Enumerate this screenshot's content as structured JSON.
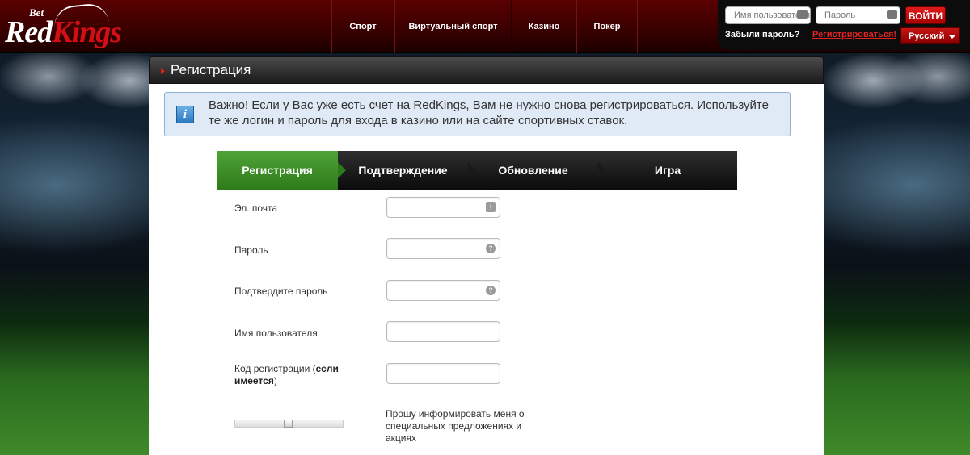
{
  "header": {
    "logo": {
      "bet": "Bet",
      "red": "Red",
      "kings": "Kings"
    },
    "nav": [
      {
        "label": "Спорт"
      },
      {
        "label": "Виртуальный спорт"
      },
      {
        "label": "Казино"
      },
      {
        "label": "Покер"
      }
    ],
    "login": {
      "username_placeholder": "Имя пользователя",
      "password_placeholder": "Пароль",
      "submit_label": "ВОЙТИ",
      "forgot_label": "Забыли пароль?",
      "register_label": "Регистрироваться!",
      "language": "Русский"
    }
  },
  "page": {
    "title": "Регистрация",
    "notice": {
      "icon": "info-icon",
      "text": "Важно! Если у Вас уже есть счет на RedKings, Вам не нужно снова регистрироваться. Используйте те же логин и пароль для входа в казино или на сайте спортивных ставок."
    },
    "steps": [
      {
        "label": "Регистрация",
        "active": true
      },
      {
        "label": "Подтверждение",
        "active": false
      },
      {
        "label": "Обновление",
        "active": false
      },
      {
        "label": "Игра",
        "active": false
      }
    ],
    "fields": {
      "email_label": "Эл. почта",
      "password_label": "Пароль",
      "confirm_label": "Подтвердите пароль",
      "username_label": "Имя пользователя",
      "regcode_label": "Код регистрации (",
      "regcode_bold": "если имеется",
      "regcode_close": ")"
    },
    "newsletter": {
      "text": "Прошу информировать меня о специальных предложениях и акциях",
      "toggle_value": 0.5
    }
  },
  "colors": {
    "brand_red": "#d30f15",
    "step_active": "#3f9129",
    "notice_bg": "#dfeaf6"
  }
}
